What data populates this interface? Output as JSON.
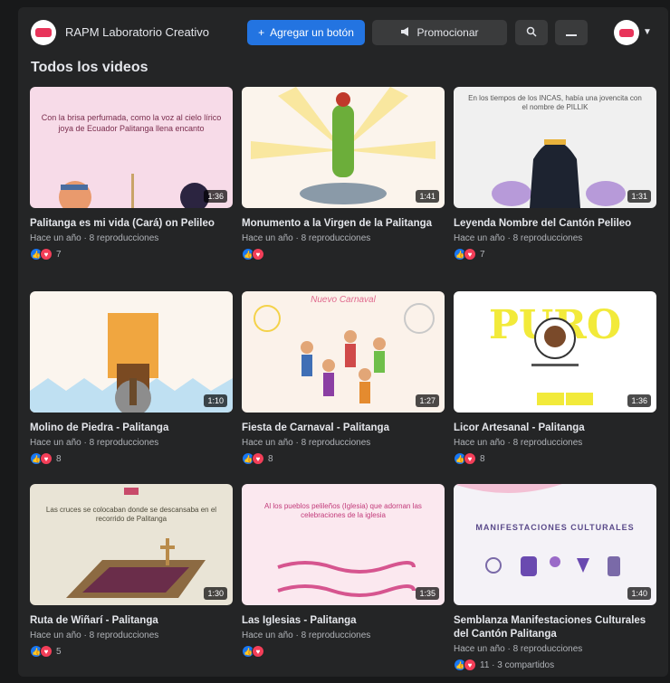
{
  "header": {
    "page_name": "RAPM Laboratorio Creativo",
    "boost_label": "Agregar un botón",
    "promote_label": "Promocionar"
  },
  "section_title": "Todos los videos",
  "videos": [
    {
      "title": "Palitanga es mi vida (Cará) on Pelileo",
      "meta": "Hace un año · 8 reproducciones",
      "reactions": "7",
      "duration": "1:36",
      "thumb_text": "Con la brisa perfumada, como la voz al cielo lírico joya de Ecuador Palitanga llena encanto",
      "thumb_bg": "#f7dbe8"
    },
    {
      "title": "Monumento a la Virgen de la Palitanga",
      "meta": "Hace un año · 8 reproducciones",
      "reactions": "",
      "duration": "1:41",
      "thumb_text": "",
      "thumb_bg": "#fbf4ec"
    },
    {
      "title": "Leyenda Nombre del Cantón Pelileo",
      "meta": "Hace un año · 8 reproducciones",
      "reactions": "7",
      "duration": "1:31",
      "thumb_text": "En los tiempos de los INCAS, había una jovencita con el nombre de PILLIK",
      "thumb_bg": "#f0f0f0"
    },
    {
      "title": "Molino de Piedra - Palitanga",
      "meta": "Hace un año · 8 reproducciones",
      "reactions": "8",
      "duration": "1:10",
      "thumb_text": "",
      "thumb_bg": "#fbf5ee"
    },
    {
      "title": "Fiesta de Carnaval - Palitanga",
      "meta": "Hace un año · 8 reproducciones",
      "reactions": "8",
      "duration": "1:27",
      "thumb_text": "Nuevo Carnaval",
      "thumb_bg": "#fbf2ea"
    },
    {
      "title": "Licor Artesanal - Palitanga",
      "meta": "Hace un año · 8 reproducciones",
      "reactions": "8",
      "duration": "1:36",
      "thumb_text": "PURO",
      "thumb_bg": "#ffffff"
    },
    {
      "title": "Ruta de Wiñarí - Palitanga",
      "meta": "Hace un año · 8 reproducciones",
      "reactions": "5",
      "duration": "1:30",
      "thumb_text": "Las cruces se colocaban donde se descansaba en el recorrido de Palitanga",
      "thumb_bg": "#e9e4d6"
    },
    {
      "title": "Las Iglesias - Palitanga",
      "meta": "Hace un año · 8 reproducciones",
      "reactions": "",
      "duration": "1:35",
      "thumb_text": "Al los pueblos pelileños (Iglesia) que adornan las celebraciones de la iglesia",
      "thumb_bg": "#fbe8ef"
    },
    {
      "title": "Semblanza Manifestaciones Culturales del Cantón Palitanga",
      "meta": "Hace un año · 8 reproducciones",
      "reactions": "11 · 3 compartidos",
      "duration": "1:40",
      "thumb_text": "MANIFESTACIONES CULTURALES",
      "thumb_bg": "#f4f2f7"
    }
  ],
  "colors": {
    "accent": "#2374e1",
    "background": "#18191a",
    "surface": "#242526",
    "like": "#1877f2",
    "love": "#f33e58"
  }
}
